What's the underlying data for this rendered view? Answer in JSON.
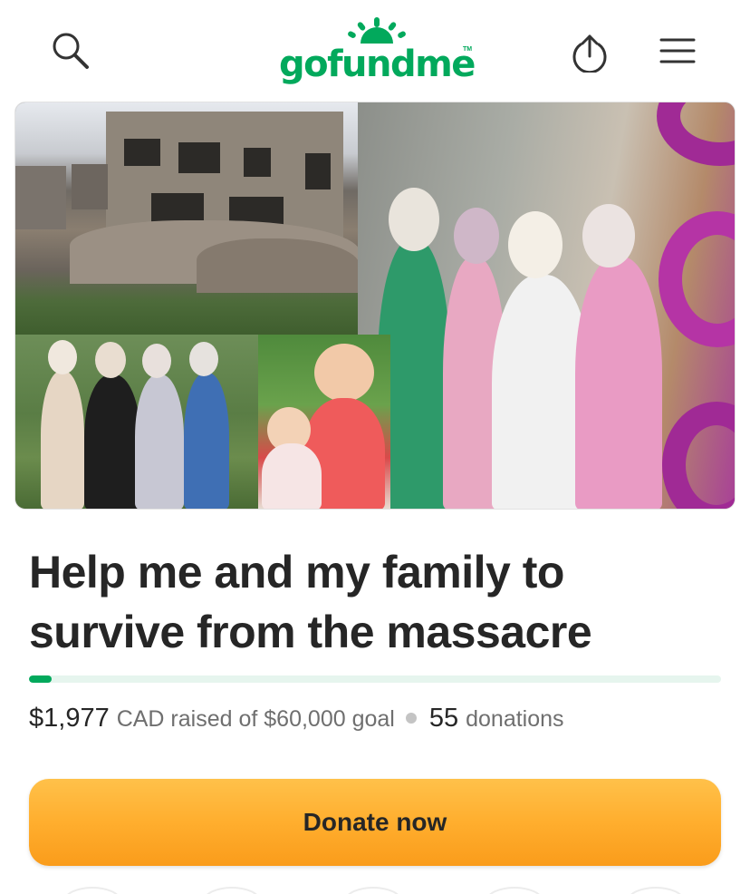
{
  "header": {
    "logo_text": "gofundme",
    "logo_tm": "TM",
    "icons": {
      "search": "search-icon",
      "share": "share-upload-icon",
      "menu": "hamburger-menu-icon"
    },
    "brand_color": "#02a95c"
  },
  "hero": {
    "tiles": [
      "destroyed-building-photo",
      "women-group-selfie-photo",
      "graduation-family-photo",
      "toddler-baby-photo"
    ]
  },
  "campaign": {
    "title": "Help me and my family to survive from the massacre",
    "progress_fraction": 0.033,
    "progress_color": "#02a95c",
    "raised": "$1,977",
    "raised_text": "CAD raised of $60,000 goal",
    "donations_count": "55",
    "donations_label": "donations"
  },
  "actions": {
    "donate_label": "Donate now",
    "donate_color": "#ffae2e"
  }
}
